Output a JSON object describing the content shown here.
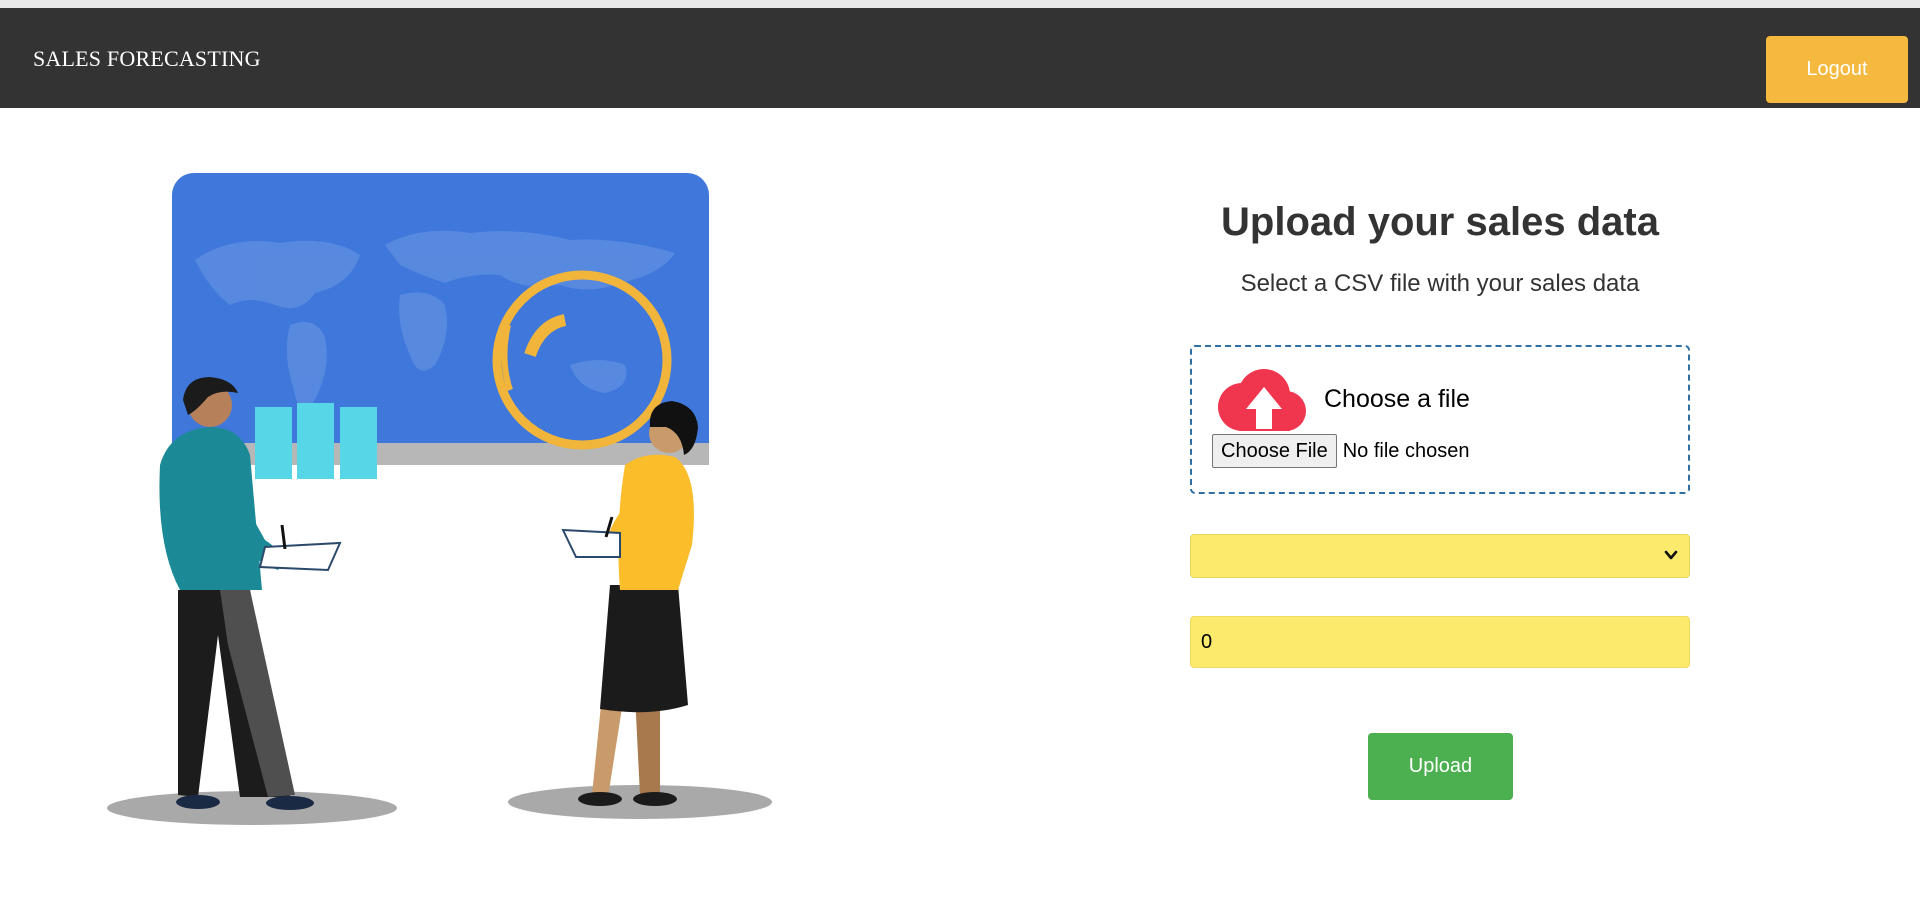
{
  "header": {
    "brand": "SALES FORECASTING",
    "logout_label": "Logout"
  },
  "form": {
    "title": "Upload your sales data",
    "subtitle": "Select a CSV file with your sales data",
    "dropzone": {
      "label": "Choose a file",
      "file_button_label": "Choose File",
      "file_status": "No file chosen",
      "icon": "cloud-upload-icon"
    },
    "select": {
      "selected_value": "",
      "icon": "chevron-down-icon"
    },
    "number_value": "0",
    "upload_label": "Upload"
  },
  "illustration": {
    "icon": "sales-presentation-illustration"
  },
  "colors": {
    "navbar": "#333333",
    "logout": "#f4b93e",
    "upload": "#4caf50",
    "input_bg": "#fbea6b",
    "dropzone_border": "#2f6fa6",
    "cloud": "#f0354f",
    "screen": "#3f77db"
  }
}
